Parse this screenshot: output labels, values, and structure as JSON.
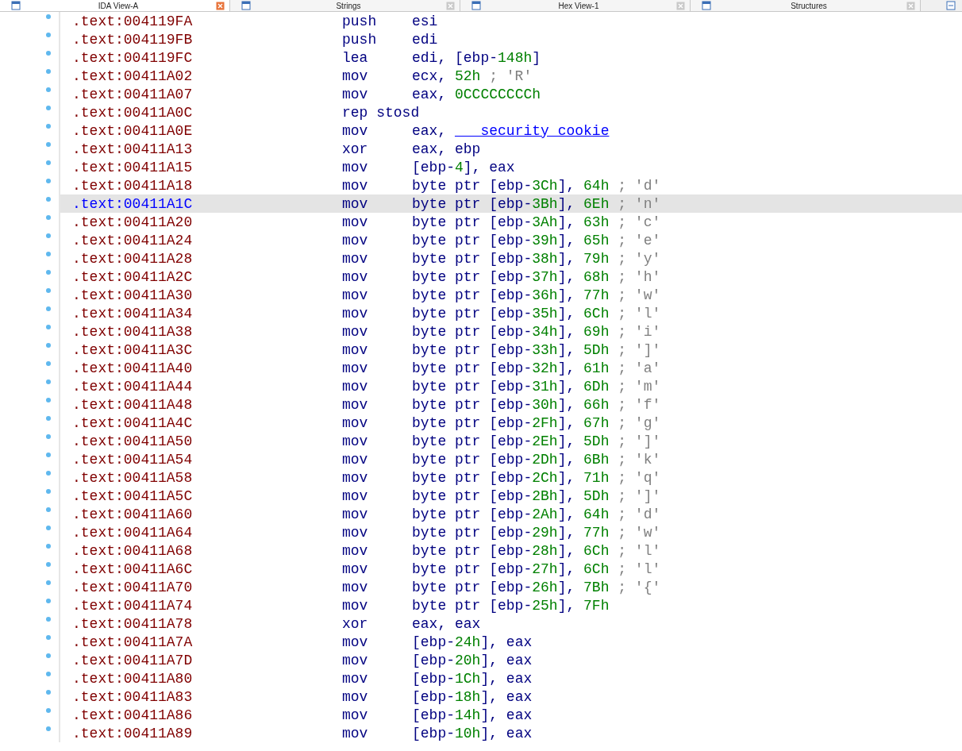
{
  "tabs": [
    {
      "label": "IDA View-A",
      "selected": true
    },
    {
      "label": "Strings",
      "selected": false
    },
    {
      "label": "Hex View-1",
      "selected": false
    },
    {
      "label": "Structures",
      "selected": false
    }
  ],
  "rows": [
    {
      "address": ".text:004119FA",
      "mnemonic": "push",
      "operands": [
        {
          "text": "esi",
          "kind": "plain"
        }
      ],
      "selected": false
    },
    {
      "address": ".text:004119FB",
      "mnemonic": "push",
      "operands": [
        {
          "text": "edi",
          "kind": "plain"
        }
      ],
      "selected": false
    },
    {
      "address": ".text:004119FC",
      "mnemonic": "lea",
      "operands": [
        {
          "text": "edi, [ebp-",
          "kind": "plain"
        },
        {
          "text": "148h",
          "kind": "num"
        },
        {
          "text": "]",
          "kind": "plain"
        }
      ],
      "selected": false
    },
    {
      "address": ".text:00411A02",
      "mnemonic": "mov",
      "operands": [
        {
          "text": "ecx, ",
          "kind": "plain"
        },
        {
          "text": "52h",
          "kind": "num"
        }
      ],
      "comment": "; 'R'",
      "selected": false
    },
    {
      "address": ".text:00411A07",
      "mnemonic": "mov",
      "operands": [
        {
          "text": "eax, ",
          "kind": "plain"
        },
        {
          "text": "0CCCCCCCCh",
          "kind": "num"
        }
      ],
      "selected": false
    },
    {
      "address": ".text:00411A0C",
      "mnemonic": "rep stosd",
      "operands": [],
      "selected": false
    },
    {
      "address": ".text:00411A0E",
      "mnemonic": "mov",
      "operands": [
        {
          "text": "eax, ",
          "kind": "plain"
        },
        {
          "text": "___security_cookie",
          "kind": "name"
        }
      ],
      "selected": false
    },
    {
      "address": ".text:00411A13",
      "mnemonic": "xor",
      "operands": [
        {
          "text": "eax, ebp",
          "kind": "plain"
        }
      ],
      "selected": false
    },
    {
      "address": ".text:00411A15",
      "mnemonic": "mov",
      "operands": [
        {
          "text": "[ebp-",
          "kind": "plain"
        },
        {
          "text": "4",
          "kind": "num"
        },
        {
          "text": "], eax",
          "kind": "plain"
        }
      ],
      "selected": false
    },
    {
      "address": ".text:00411A18",
      "mnemonic": "mov",
      "operands": [
        {
          "text": "byte ptr [ebp-",
          "kind": "plain"
        },
        {
          "text": "3Ch",
          "kind": "num"
        },
        {
          "text": "], ",
          "kind": "plain"
        },
        {
          "text": "64h",
          "kind": "num"
        }
      ],
      "comment": "; 'd'",
      "selected": false
    },
    {
      "address": ".text:00411A1C",
      "mnemonic": "mov",
      "operands": [
        {
          "text": "byte ptr [ebp-",
          "kind": "plain"
        },
        {
          "text": "3Bh",
          "kind": "num"
        },
        {
          "text": "], ",
          "kind": "plain"
        },
        {
          "text": "6Eh",
          "kind": "num"
        }
      ],
      "comment": "; 'n'",
      "selected": true
    },
    {
      "address": ".text:00411A20",
      "mnemonic": "mov",
      "operands": [
        {
          "text": "byte ptr [ebp-",
          "kind": "plain"
        },
        {
          "text": "3Ah",
          "kind": "num"
        },
        {
          "text": "], ",
          "kind": "plain"
        },
        {
          "text": "63h",
          "kind": "num"
        }
      ],
      "comment": "; 'c'",
      "selected": false
    },
    {
      "address": ".text:00411A24",
      "mnemonic": "mov",
      "operands": [
        {
          "text": "byte ptr [ebp-",
          "kind": "plain"
        },
        {
          "text": "39h",
          "kind": "num"
        },
        {
          "text": "], ",
          "kind": "plain"
        },
        {
          "text": "65h",
          "kind": "num"
        }
      ],
      "comment": "; 'e'",
      "selected": false
    },
    {
      "address": ".text:00411A28",
      "mnemonic": "mov",
      "operands": [
        {
          "text": "byte ptr [ebp-",
          "kind": "plain"
        },
        {
          "text": "38h",
          "kind": "num"
        },
        {
          "text": "], ",
          "kind": "plain"
        },
        {
          "text": "79h",
          "kind": "num"
        }
      ],
      "comment": "; 'y'",
      "selected": false
    },
    {
      "address": ".text:00411A2C",
      "mnemonic": "mov",
      "operands": [
        {
          "text": "byte ptr [ebp-",
          "kind": "plain"
        },
        {
          "text": "37h",
          "kind": "num"
        },
        {
          "text": "], ",
          "kind": "plain"
        },
        {
          "text": "68h",
          "kind": "num"
        }
      ],
      "comment": "; 'h'",
      "selected": false
    },
    {
      "address": ".text:00411A30",
      "mnemonic": "mov",
      "operands": [
        {
          "text": "byte ptr [ebp-",
          "kind": "plain"
        },
        {
          "text": "36h",
          "kind": "num"
        },
        {
          "text": "], ",
          "kind": "plain"
        },
        {
          "text": "77h",
          "kind": "num"
        }
      ],
      "comment": "; 'w'",
      "selected": false
    },
    {
      "address": ".text:00411A34",
      "mnemonic": "mov",
      "operands": [
        {
          "text": "byte ptr [ebp-",
          "kind": "plain"
        },
        {
          "text": "35h",
          "kind": "num"
        },
        {
          "text": "], ",
          "kind": "plain"
        },
        {
          "text": "6Ch",
          "kind": "num"
        }
      ],
      "comment": "; 'l'",
      "selected": false
    },
    {
      "address": ".text:00411A38",
      "mnemonic": "mov",
      "operands": [
        {
          "text": "byte ptr [ebp-",
          "kind": "plain"
        },
        {
          "text": "34h",
          "kind": "num"
        },
        {
          "text": "], ",
          "kind": "plain"
        },
        {
          "text": "69h",
          "kind": "num"
        }
      ],
      "comment": "; 'i'",
      "selected": false
    },
    {
      "address": ".text:00411A3C",
      "mnemonic": "mov",
      "operands": [
        {
          "text": "byte ptr [ebp-",
          "kind": "plain"
        },
        {
          "text": "33h",
          "kind": "num"
        },
        {
          "text": "], ",
          "kind": "plain"
        },
        {
          "text": "5Dh",
          "kind": "num"
        }
      ],
      "comment": "; ']'",
      "selected": false
    },
    {
      "address": ".text:00411A40",
      "mnemonic": "mov",
      "operands": [
        {
          "text": "byte ptr [ebp-",
          "kind": "plain"
        },
        {
          "text": "32h",
          "kind": "num"
        },
        {
          "text": "], ",
          "kind": "plain"
        },
        {
          "text": "61h",
          "kind": "num"
        }
      ],
      "comment": "; 'a'",
      "selected": false
    },
    {
      "address": ".text:00411A44",
      "mnemonic": "mov",
      "operands": [
        {
          "text": "byte ptr [ebp-",
          "kind": "plain"
        },
        {
          "text": "31h",
          "kind": "num"
        },
        {
          "text": "], ",
          "kind": "plain"
        },
        {
          "text": "6Dh",
          "kind": "num"
        }
      ],
      "comment": "; 'm'",
      "selected": false
    },
    {
      "address": ".text:00411A48",
      "mnemonic": "mov",
      "operands": [
        {
          "text": "byte ptr [ebp-",
          "kind": "plain"
        },
        {
          "text": "30h",
          "kind": "num"
        },
        {
          "text": "], ",
          "kind": "plain"
        },
        {
          "text": "66h",
          "kind": "num"
        }
      ],
      "comment": "; 'f'",
      "selected": false
    },
    {
      "address": ".text:00411A4C",
      "mnemonic": "mov",
      "operands": [
        {
          "text": "byte ptr [ebp-",
          "kind": "plain"
        },
        {
          "text": "2Fh",
          "kind": "num"
        },
        {
          "text": "], ",
          "kind": "plain"
        },
        {
          "text": "67h",
          "kind": "num"
        }
      ],
      "comment": "; 'g'",
      "selected": false
    },
    {
      "address": ".text:00411A50",
      "mnemonic": "mov",
      "operands": [
        {
          "text": "byte ptr [ebp-",
          "kind": "plain"
        },
        {
          "text": "2Eh",
          "kind": "num"
        },
        {
          "text": "], ",
          "kind": "plain"
        },
        {
          "text": "5Dh",
          "kind": "num"
        }
      ],
      "comment": "; ']'",
      "selected": false
    },
    {
      "address": ".text:00411A54",
      "mnemonic": "mov",
      "operands": [
        {
          "text": "byte ptr [ebp-",
          "kind": "plain"
        },
        {
          "text": "2Dh",
          "kind": "num"
        },
        {
          "text": "], ",
          "kind": "plain"
        },
        {
          "text": "6Bh",
          "kind": "num"
        }
      ],
      "comment": "; 'k'",
      "selected": false
    },
    {
      "address": ".text:00411A58",
      "mnemonic": "mov",
      "operands": [
        {
          "text": "byte ptr [ebp-",
          "kind": "plain"
        },
        {
          "text": "2Ch",
          "kind": "num"
        },
        {
          "text": "], ",
          "kind": "plain"
        },
        {
          "text": "71h",
          "kind": "num"
        }
      ],
      "comment": "; 'q'",
      "selected": false
    },
    {
      "address": ".text:00411A5C",
      "mnemonic": "mov",
      "operands": [
        {
          "text": "byte ptr [ebp-",
          "kind": "plain"
        },
        {
          "text": "2Bh",
          "kind": "num"
        },
        {
          "text": "], ",
          "kind": "plain"
        },
        {
          "text": "5Dh",
          "kind": "num"
        }
      ],
      "comment": "; ']'",
      "selected": false
    },
    {
      "address": ".text:00411A60",
      "mnemonic": "mov",
      "operands": [
        {
          "text": "byte ptr [ebp-",
          "kind": "plain"
        },
        {
          "text": "2Ah",
          "kind": "num"
        },
        {
          "text": "], ",
          "kind": "plain"
        },
        {
          "text": "64h",
          "kind": "num"
        }
      ],
      "comment": "; 'd'",
      "selected": false
    },
    {
      "address": ".text:00411A64",
      "mnemonic": "mov",
      "operands": [
        {
          "text": "byte ptr [ebp-",
          "kind": "plain"
        },
        {
          "text": "29h",
          "kind": "num"
        },
        {
          "text": "], ",
          "kind": "plain"
        },
        {
          "text": "77h",
          "kind": "num"
        }
      ],
      "comment": "; 'w'",
      "selected": false
    },
    {
      "address": ".text:00411A68",
      "mnemonic": "mov",
      "operands": [
        {
          "text": "byte ptr [ebp-",
          "kind": "plain"
        },
        {
          "text": "28h",
          "kind": "num"
        },
        {
          "text": "], ",
          "kind": "plain"
        },
        {
          "text": "6Ch",
          "kind": "num"
        }
      ],
      "comment": "; 'l'",
      "selected": false
    },
    {
      "address": ".text:00411A6C",
      "mnemonic": "mov",
      "operands": [
        {
          "text": "byte ptr [ebp-",
          "kind": "plain"
        },
        {
          "text": "27h",
          "kind": "num"
        },
        {
          "text": "], ",
          "kind": "plain"
        },
        {
          "text": "6Ch",
          "kind": "num"
        }
      ],
      "comment": "; 'l'",
      "selected": false
    },
    {
      "address": ".text:00411A70",
      "mnemonic": "mov",
      "operands": [
        {
          "text": "byte ptr [ebp-",
          "kind": "plain"
        },
        {
          "text": "26h",
          "kind": "num"
        },
        {
          "text": "], ",
          "kind": "plain"
        },
        {
          "text": "7Bh",
          "kind": "num"
        }
      ],
      "comment": "; '{'",
      "selected": false
    },
    {
      "address": ".text:00411A74",
      "mnemonic": "mov",
      "operands": [
        {
          "text": "byte ptr [ebp-",
          "kind": "plain"
        },
        {
          "text": "25h",
          "kind": "num"
        },
        {
          "text": "], ",
          "kind": "plain"
        },
        {
          "text": "7Fh",
          "kind": "num"
        }
      ],
      "selected": false
    },
    {
      "address": ".text:00411A78",
      "mnemonic": "xor",
      "operands": [
        {
          "text": "eax, eax",
          "kind": "plain"
        }
      ],
      "selected": false
    },
    {
      "address": ".text:00411A7A",
      "mnemonic": "mov",
      "operands": [
        {
          "text": "[ebp-",
          "kind": "plain"
        },
        {
          "text": "24h",
          "kind": "num"
        },
        {
          "text": "], eax",
          "kind": "plain"
        }
      ],
      "selected": false
    },
    {
      "address": ".text:00411A7D",
      "mnemonic": "mov",
      "operands": [
        {
          "text": "[ebp-",
          "kind": "plain"
        },
        {
          "text": "20h",
          "kind": "num"
        },
        {
          "text": "], eax",
          "kind": "plain"
        }
      ],
      "selected": false
    },
    {
      "address": ".text:00411A80",
      "mnemonic": "mov",
      "operands": [
        {
          "text": "[ebp-",
          "kind": "plain"
        },
        {
          "text": "1Ch",
          "kind": "num"
        },
        {
          "text": "], eax",
          "kind": "plain"
        }
      ],
      "selected": false
    },
    {
      "address": ".text:00411A83",
      "mnemonic": "mov",
      "operands": [
        {
          "text": "[ebp-",
          "kind": "plain"
        },
        {
          "text": "18h",
          "kind": "num"
        },
        {
          "text": "], eax",
          "kind": "plain"
        }
      ],
      "selected": false
    },
    {
      "address": ".text:00411A86",
      "mnemonic": "mov",
      "operands": [
        {
          "text": "[ebp-",
          "kind": "plain"
        },
        {
          "text": "14h",
          "kind": "num"
        },
        {
          "text": "], eax",
          "kind": "plain"
        }
      ],
      "selected": false
    },
    {
      "address": ".text:00411A89",
      "mnemonic": "mov",
      "operands": [
        {
          "text": "[ebp-",
          "kind": "plain"
        },
        {
          "text": "10h",
          "kind": "num"
        },
        {
          "text": "], eax",
          "kind": "plain"
        }
      ],
      "selected": false
    }
  ]
}
